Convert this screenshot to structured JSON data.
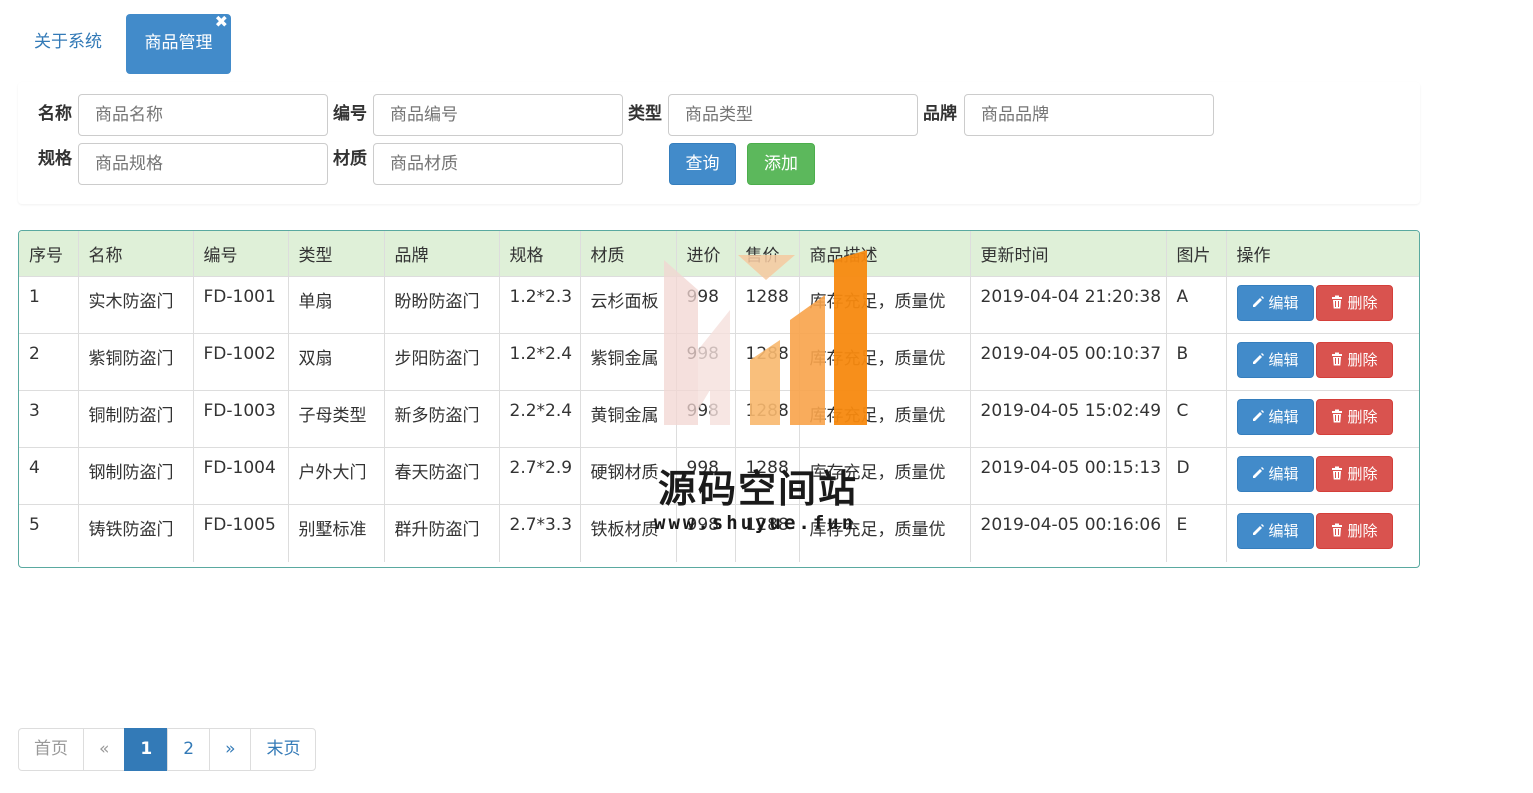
{
  "tabs": {
    "items": [
      {
        "label": "关于系统"
      },
      {
        "label": "商品管理"
      }
    ],
    "close_symbol": "✖"
  },
  "search": {
    "fields": [
      {
        "label": "名称",
        "placeholder": "商品名称"
      },
      {
        "label": "编号",
        "placeholder": "商品编号"
      },
      {
        "label": "类型",
        "placeholder": "商品类型"
      },
      {
        "label": "品牌",
        "placeholder": "商品品牌"
      },
      {
        "label": "规格",
        "placeholder": "商品规格"
      },
      {
        "label": "材质",
        "placeholder": "商品材质"
      }
    ],
    "query_label": "查询",
    "add_label": "添加"
  },
  "table": {
    "headers": [
      "序号",
      "名称",
      "编号",
      "类型",
      "品牌",
      "规格",
      "材质",
      "进价",
      "售价",
      "商品描述",
      "更新时间",
      "图片",
      "操作"
    ],
    "rows": [
      {
        "no": "1",
        "name": "实木防盗门",
        "code": "FD-1001",
        "type": "单扇",
        "brand": "盼盼防盗门",
        "spec": "1.2*2.3",
        "material": "云杉面板",
        "cost": "998",
        "price": "1288",
        "desc": "库存充足，质量优",
        "updated": "2019-04-04 21:20:38",
        "image": "A"
      },
      {
        "no": "2",
        "name": "紫铜防盗门",
        "code": "FD-1002",
        "type": "双扇",
        "brand": "步阳防盗门",
        "spec": "1.2*2.4",
        "material": "紫铜金属",
        "cost": "998",
        "price": "1288",
        "desc": "库存充足，质量优",
        "updated": "2019-04-05 00:10:37",
        "image": "B"
      },
      {
        "no": "3",
        "name": "铜制防盗门",
        "code": "FD-1003",
        "type": "子母类型",
        "brand": "新多防盗门",
        "spec": "2.2*2.4",
        "material": "黄铜金属",
        "cost": "998",
        "price": "1288",
        "desc": "库存充足，质量优",
        "updated": "2019-04-05 15:02:49",
        "image": "C"
      },
      {
        "no": "4",
        "name": "钢制防盗门",
        "code": "FD-1004",
        "type": "户外大门",
        "brand": "春天防盗门",
        "spec": "2.7*2.9",
        "material": "硬钢材质",
        "cost": "998",
        "price": "1288",
        "desc": "库存充足，质量优",
        "updated": "2019-04-05 00:15:13",
        "image": "D"
      },
      {
        "no": "5",
        "name": "铸铁防盗门",
        "code": "FD-1005",
        "type": "别墅标准",
        "brand": "群升防盗门",
        "spec": "2.7*3.3",
        "material": "铁板材质",
        "cost": "998",
        "price": "1288",
        "desc": "库存充足，质量优",
        "updated": "2019-04-05 00:16:06",
        "image": "E"
      }
    ],
    "edit_label": "编辑",
    "delete_label": "删除",
    "header_bg": "#dff0d8",
    "border_color": "#5aa9a0"
  },
  "pagination": {
    "items": [
      {
        "label": "首页",
        "state": "disabled"
      },
      {
        "label": "«",
        "state": "disabled"
      },
      {
        "label": "1",
        "state": "active"
      },
      {
        "label": "2",
        "state": "link"
      },
      {
        "label": "»",
        "state": "link"
      },
      {
        "label": "末页",
        "state": "link"
      }
    ]
  },
  "watermark": {
    "text": "源码空间站",
    "url": "www.shuyue.fun"
  },
  "colors": {
    "primary": "#428bca",
    "success": "#5cb85c",
    "danger": "#d9534f",
    "link": "#337ab7"
  }
}
